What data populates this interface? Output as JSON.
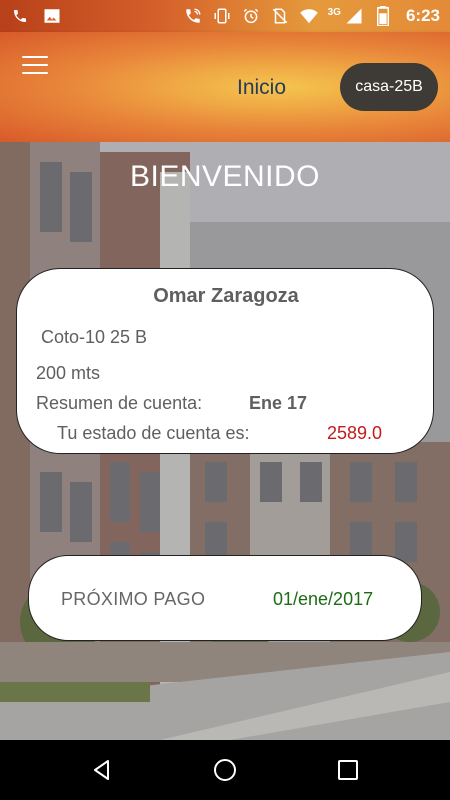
{
  "status_bar": {
    "time": "6:23",
    "network_label": "3G",
    "left_icons": [
      "phone-icon",
      "image-icon"
    ],
    "right_icons": [
      "wifi-calling-icon",
      "vibrate-icon",
      "alarm-icon",
      "no-sim-icon",
      "signal-icon",
      "battery-icon"
    ]
  },
  "app_bar": {
    "title": "Inicio",
    "house_chip": "casa-25B",
    "menu_icon": "menu-icon"
  },
  "main": {
    "welcome": "BIENVENIDO"
  },
  "account_card": {
    "owner_name": "Omar Zaragoza",
    "property": "Coto-10 25 B",
    "area": "200 mts",
    "summary_label": "Resumen de cuenta:",
    "summary_value": "Ene 17",
    "status_label": "Tu estado de cuenta es:",
    "status_value": "2589.0",
    "status_color": "#c41a1a"
  },
  "payment_card": {
    "label": "PRÓXIMO PAGO",
    "date": "01/ene/2017",
    "date_color": "#1e6b14"
  },
  "nav_bar": {
    "buttons": [
      "back-icon",
      "home-icon",
      "recents-icon"
    ]
  },
  "colors": {
    "accent_orange": "#e8853a",
    "chip_background": "#3e3a36",
    "title_color": "#2b3a5a"
  }
}
